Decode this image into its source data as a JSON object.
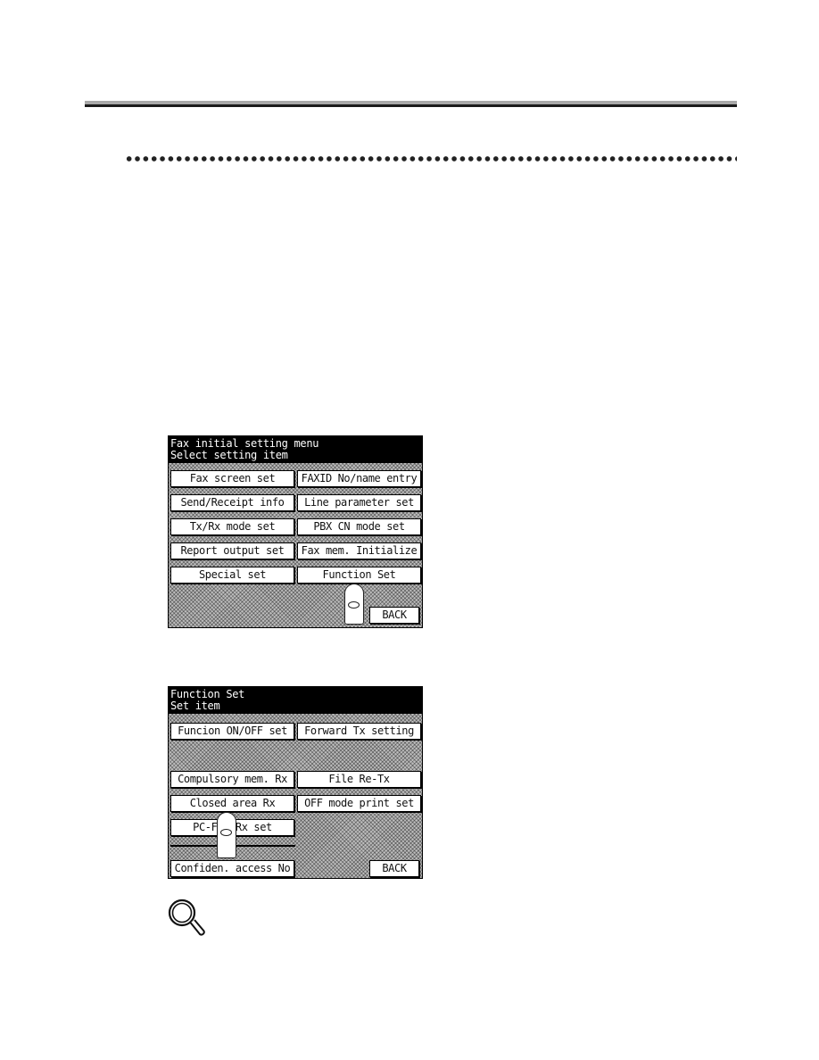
{
  "screens": [
    {
      "header": {
        "line1": "Fax initial setting menu",
        "line2": "Select setting item"
      },
      "buttons": [
        "Fax screen set",
        "FAXID No/name entry",
        "Send/Receipt info",
        "Line parameter set",
        "Tx/Rx mode set",
        "PBX CN mode set",
        "Report output set",
        "Fax mem. Initialize",
        "Special set",
        "Function Set"
      ],
      "back_label": "BACK"
    },
    {
      "header": {
        "line1": "Function Set",
        "line2": "Set item"
      },
      "buttons": [
        "Funcion ON/OFF set",
        "Forward Tx setting",
        "Compulsory mem. Rx",
        "File Re-Tx",
        "Closed area Rx",
        "OFF mode print set",
        "PC-FAX Rx set",
        "Confiden. access No"
      ],
      "back_label": "BACK"
    }
  ],
  "icons": {
    "pointer": "finger-press-icon",
    "tip": "magnifier-icon"
  },
  "colors": {
    "rule_gray": "#a8a8a8",
    "rule_black": "#1a1a1a",
    "screen_header_bg": "#000000",
    "screen_header_text": "#ffffff"
  }
}
